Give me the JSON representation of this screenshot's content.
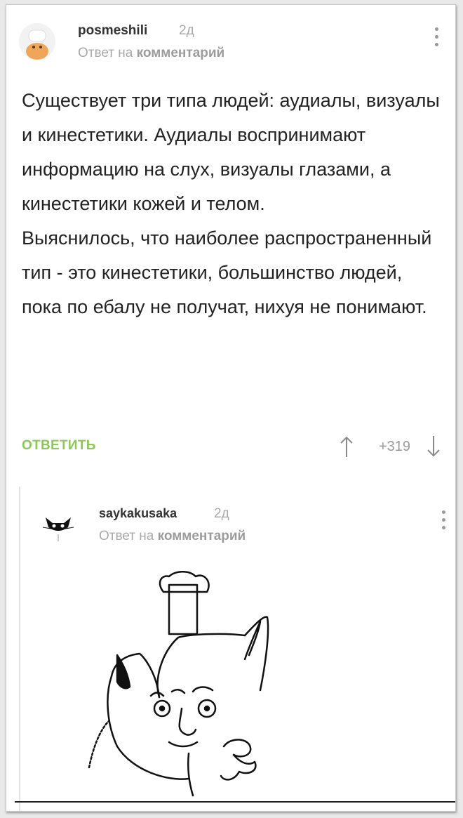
{
  "comment": {
    "username": "posmeshili",
    "time": "2д",
    "reply_prefix": "Ответ на",
    "reply_link": "комментарий",
    "text_paragraphs": [
      "Существует три типа людей: аудиалы, визуалы и кинестетики. Аудиалы воспринимают информацию на слух, визуалы глазами, а кинестетики кожей и телом.",
      "Выяснилось, что наиболее распространенный тип - это кинестетики, большинство людей, пока по ебалу не получат, нихуя не понимают."
    ],
    "reply_button": "ОТВЕТИТЬ",
    "score": "+319",
    "avatar_icon": "chef-avatar-icon",
    "menu_icon": "more-vertical-icon",
    "vote_up_icon": "arrow-up-icon",
    "vote_down_icon": "arrow-down-icon"
  },
  "reply": {
    "username": "saykakusaka",
    "time": "2д",
    "reply_prefix": "Ответ на",
    "reply_link": "комментарий",
    "avatar_icon": "cat-avatar-icon",
    "menu_icon": "more-vertical-icon",
    "image_icon": "cat-chef-drawing-icon"
  },
  "colors": {
    "accent_green": "#8ac858",
    "muted_text": "#a8a8a8",
    "body_text": "#222222"
  }
}
